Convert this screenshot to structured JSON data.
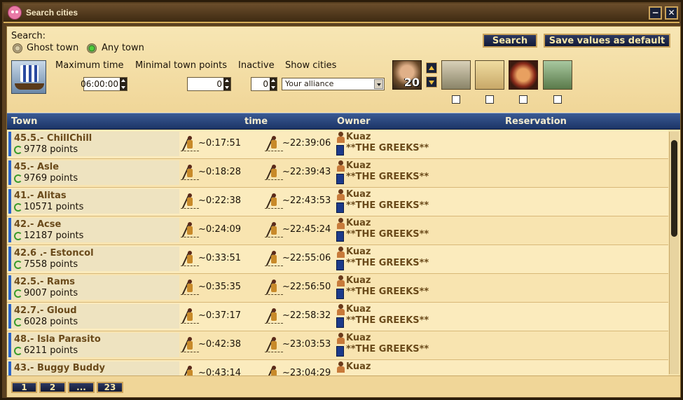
{
  "window": {
    "title": "Search cities"
  },
  "search": {
    "label": "Search:",
    "radio_ghost": "Ghost town",
    "radio_any": "Any town",
    "max_time_label": "Maximum time",
    "max_time_value": "06:00:00",
    "min_points_label": "Minimal town points",
    "min_points_value": "0",
    "inactive_label": "Inactive",
    "inactive_value": "0",
    "show_cities_label": "Show cities",
    "show_cities_value": "Your alliance",
    "search_button": "Search",
    "save_default_button": "Save values as default",
    "unit_count": "20"
  },
  "table": {
    "headers": {
      "town": "Town",
      "time": "time",
      "owner": "Owner",
      "reservation": "Reservation"
    },
    "rows": [
      {
        "town": "45.5.- ChillChill",
        "points": "9778 points",
        "time1": "~0:17:51",
        "time2": "~22:39:06",
        "owner": "Kuaz",
        "alliance": "**THE GREEKS**"
      },
      {
        "town": "45.- Asle",
        "points": "9769 points",
        "time1": "~0:18:28",
        "time2": "~22:39:43",
        "owner": "Kuaz",
        "alliance": "**THE GREEKS**"
      },
      {
        "town": "41.- Alitas",
        "points": "10571 points",
        "time1": "~0:22:38",
        "time2": "~22:43:53",
        "owner": "Kuaz",
        "alliance": "**THE GREEKS**"
      },
      {
        "town": "42.- Acse",
        "points": "12187 points",
        "time1": "~0:24:09",
        "time2": "~22:45:24",
        "owner": "Kuaz",
        "alliance": "**THE GREEKS**"
      },
      {
        "town": "42.6 .- Estoncol",
        "points": "7558 points",
        "time1": "~0:33:51",
        "time2": "~22:55:06",
        "owner": "Kuaz",
        "alliance": "**THE GREEKS**"
      },
      {
        "town": "42.5.- Rams",
        "points": "9007 points",
        "time1": "~0:35:35",
        "time2": "~22:56:50",
        "owner": "Kuaz",
        "alliance": "**THE GREEKS**"
      },
      {
        "town": "42.7.- Gloud",
        "points": "6028 points",
        "time1": "~0:37:17",
        "time2": "~22:58:32",
        "owner": "Kuaz",
        "alliance": "**THE GREEKS**"
      },
      {
        "town": "48.- Isla Parasito",
        "points": "6211 points",
        "time1": "~0:42:38",
        "time2": "~23:03:53",
        "owner": "Kuaz",
        "alliance": "**THE GREEKS**"
      },
      {
        "town": "43.- Buggy Buddy",
        "points": "",
        "time1": "~0:43:14",
        "time2": "~23:04:29",
        "owner": "Kuaz",
        "alliance": ""
      }
    ]
  },
  "pagination": {
    "p1": "1",
    "p2": "2",
    "ellipsis": "...",
    "last": "23"
  },
  "colors": {
    "header_blue": "#1c3466",
    "accent_gold": "#c9a25a",
    "town_text": "#6a4a1a"
  }
}
